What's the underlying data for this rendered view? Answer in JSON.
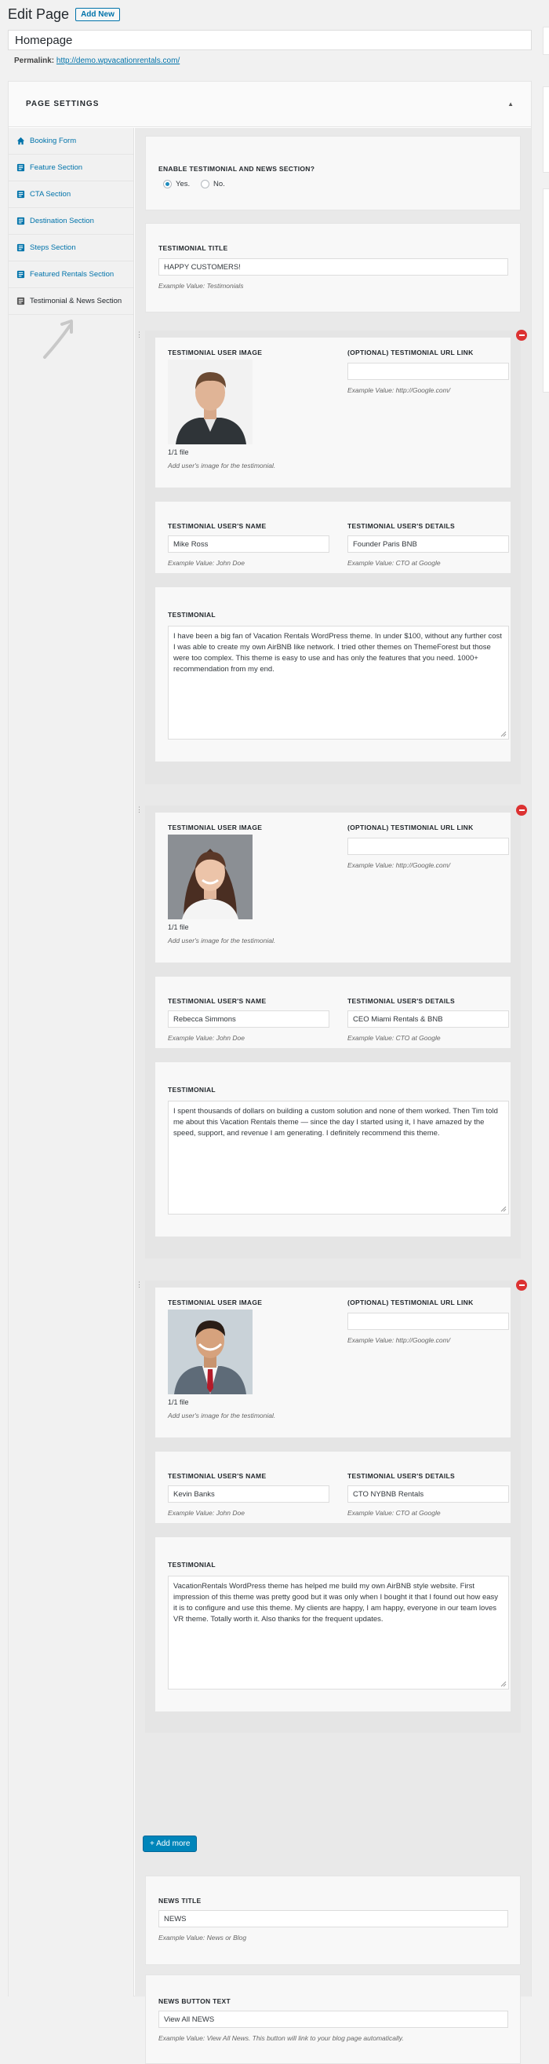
{
  "header": {
    "title": "Edit Page",
    "add_new": "Add New"
  },
  "post": {
    "title": "Homepage",
    "permalink_label": "Permalink:",
    "permalink_url": "http://demo.wpvacationrentals.com/"
  },
  "settings": {
    "heading": "PAGE SETTINGS",
    "nav": [
      {
        "label": "Booking Form",
        "icon": "home-icon"
      },
      {
        "label": "Feature Section",
        "icon": "admin-page-icon"
      },
      {
        "label": "CTA Section",
        "icon": "admin-page-icon"
      },
      {
        "label": "Destination Section",
        "icon": "admin-page-icon"
      },
      {
        "label": "Steps Section",
        "icon": "admin-page-icon"
      },
      {
        "label": "Featured Rentals Section",
        "icon": "admin-page-icon"
      },
      {
        "label": "Testimonial & News Section",
        "icon": "admin-page-icon"
      }
    ]
  },
  "enable": {
    "label": "ENABLE TESTIMONIAL AND NEWS SECTION?",
    "yes": "Yes.",
    "no": "No.",
    "selected": "yes"
  },
  "testimonial_title": {
    "label": "TESTIMONIAL TITLE",
    "value": "HAPPY CUSTOMERS!",
    "example": "Example Value: Testimonials"
  },
  "labels": {
    "image": "TESTIMONIAL USER IMAGE",
    "url": "(OPTIONAL) TESTIMONIAL URL LINK",
    "url_example": "Example Value: http://Google.com/",
    "file_count": "1/1 file",
    "image_help": "Add user's image for the testimonial.",
    "name": "TESTIMONIAL USER'S NAME",
    "name_example": "Example Value: John Doe",
    "details": "TESTIMONIAL USER'S DETAILS",
    "details_example": "Example Value: CTO at Google",
    "testimonial": "TESTIMONIAL"
  },
  "testimonials": [
    {
      "name": "Mike Ross",
      "details": "Founder Paris BNB",
      "url": "",
      "text": "I have been a big fan of Vacation Rentals WordPress theme. In under $100, without any further cost I was able to create my own AirBNB like network. I tried other themes on ThemeForest but those were too complex. This theme is easy to use and has only the features that you need. 1000+ recommendation from my end."
    },
    {
      "name": "Rebecca Simmons",
      "details": "CEO Miami Rentals & BNB",
      "url": "",
      "text": "I spent thousands of dollars on building a custom solution and none of them worked. Then Tim told me about this Vacation Rentals theme — since the day I started using it, I have amazed by the speed, support, and revenue I am generating. I definitely recommend this theme."
    },
    {
      "name": "Kevin Banks",
      "details": "CTO NYBNB Rentals",
      "url": "",
      "text": "VacationRentals WordPress theme has helped me build my own AirBNB style website. First impression of this theme was pretty good but it was only when I bought it that I found out how easy it is to configure and use this theme. My clients are happy, I am happy, everyone in our team loves VR theme. Totally worth it. Also thanks for the frequent updates."
    }
  ],
  "add_more": "+ Add more",
  "news_title": {
    "label": "NEWS TITLE",
    "value": "NEWS",
    "example": "Example Value: News or Blog"
  },
  "news_button": {
    "label": "NEWS BUTTON TEXT",
    "value": "View All NEWS",
    "example": "Example Value: View All News. This button will link to your blog page automatically."
  },
  "colors": {
    "link": "#0073aa",
    "primary_button": "#0085ba",
    "remove": "#dc3232",
    "radio_selected": "#1e8cbe"
  }
}
